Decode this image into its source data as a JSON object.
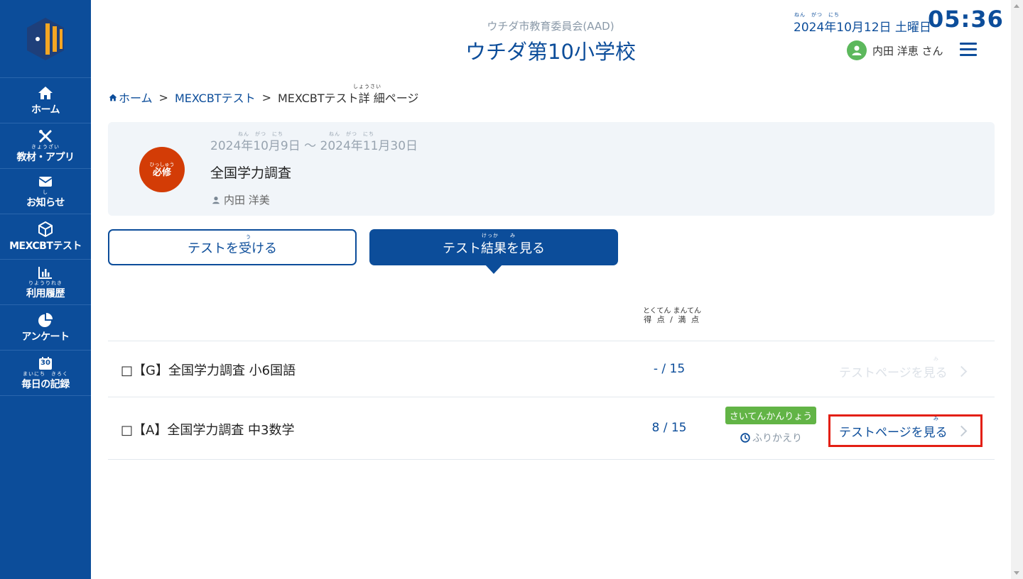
{
  "sidebar": {
    "logo": "app-logo",
    "items": [
      {
        "icon": "home-icon",
        "ruby": "",
        "label": "ホーム"
      },
      {
        "icon": "tools-icon",
        "ruby": "きょうざい",
        "label": "教材・アプリ"
      },
      {
        "icon": "mail-icon",
        "ruby": "し",
        "label": "お知らせ"
      },
      {
        "icon": "cube-icon",
        "ruby": "",
        "label": "MEXCBTテスト"
      },
      {
        "icon": "bar-chart-icon",
        "ruby": "りようりれき",
        "label": "利用履歴"
      },
      {
        "icon": "pie-chart-icon",
        "ruby": "",
        "label": "アンケート"
      },
      {
        "icon": "calendar-icon",
        "ruby": "まいにち　きろく",
        "label": "毎日の記録",
        "calendar_day": "30"
      }
    ]
  },
  "header": {
    "org": "ウチダ市教育委員会(AAD)",
    "school": "ウチダ第10小学校",
    "date_ruby": "ねん　がつ　にち",
    "date": "2024年10月12日 土曜日",
    "time": "05:36",
    "user_name": "内田 洋恵 さん"
  },
  "breadcrumb": {
    "home": "ホーム",
    "sep": ">",
    "mexcbt": "MEXCBTテスト",
    "current": "MEXCBTテスト詳 細ページ",
    "current_ruby": "しょうさい"
  },
  "card": {
    "badge_ruby": "ひっしゅう",
    "badge": "必修",
    "period_ruby": "ねん　がつ　にち　　　　　　　　ねん　がつ　にち",
    "period": "2024年10月9日 ～ 2024年11月30日",
    "title": "全国学力調査",
    "author": "内田 洋美"
  },
  "buttons": {
    "take_ruby": "う",
    "take": "テストを受ける",
    "results_ruby": "けっか　　み",
    "results": "テスト結果を見る"
  },
  "table": {
    "score_head_ruby": "とくてん まんてん",
    "score_head": "得 点 / 満 点",
    "rows": [
      {
        "title": "□【G】全国学力調査 小6国語",
        "score": "- / 15",
        "link_ruby": "み",
        "link": "テストページを見る",
        "enabled": false
      },
      {
        "title": "□【A】全国学力調査 中3数学",
        "score": "8 / 15",
        "tag": "さいてんかんりょう",
        "review": "ふりかえり",
        "link_ruby": "み",
        "link": "テストページを見る",
        "enabled": true
      }
    ]
  },
  "colors": {
    "primary": "#0c4d9a",
    "badge": "#d33c06",
    "tag": "#62b446",
    "highlight": "#e31f14"
  }
}
